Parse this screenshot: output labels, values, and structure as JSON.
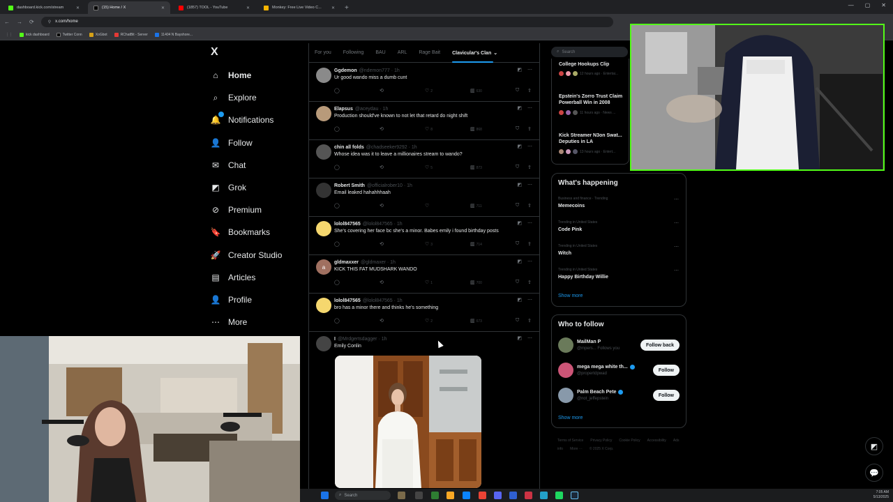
{
  "browser": {
    "tabs": [
      {
        "label": "dashboard.kick.com/stream",
        "color": "#53fc18",
        "active": false
      },
      {
        "label": "(15) Home / X",
        "color": "#000000",
        "active": true
      },
      {
        "label": "(1857) TOOL - YouTube",
        "color": "#ff0000",
        "active": false
      },
      {
        "label": "Monkey: Free Live Video C...",
        "color": "#f5b400",
        "active": false
      }
    ],
    "new_tab": "+",
    "address": "x.com/home",
    "bookmarks": [
      {
        "label": "kick dashboard",
        "color": "#53fc18"
      },
      {
        "label": "Twitter Conn",
        "color": "#000000"
      },
      {
        "label": "XoGbot",
        "color": "#d4a017"
      },
      {
        "label": "RChatBit - Server",
        "color": "#e53935"
      },
      {
        "label": "11404 N Bayshore...",
        "color": "#1a73e8"
      }
    ]
  },
  "x": {
    "logo": "X",
    "nav": [
      {
        "label": "Home",
        "icon": "home-icon",
        "glyph": "⌂",
        "bold": true
      },
      {
        "label": "Explore",
        "icon": "search-icon",
        "glyph": "⌕"
      },
      {
        "label": "Notifications",
        "icon": "bell-icon",
        "glyph": "🔔",
        "badge": true
      },
      {
        "label": "Follow",
        "icon": "person-plus-icon",
        "glyph": "👤"
      },
      {
        "label": "Chat",
        "icon": "mail-icon",
        "glyph": "✉"
      },
      {
        "label": "Grok",
        "icon": "grok-icon",
        "glyph": "◩"
      },
      {
        "label": "Premium",
        "icon": "premium-icon",
        "glyph": "⊘"
      },
      {
        "label": "Bookmarks",
        "icon": "bookmark-icon",
        "glyph": "🔖"
      },
      {
        "label": "Creator Studio",
        "icon": "rocket-icon",
        "glyph": "🚀"
      },
      {
        "label": "Articles",
        "icon": "article-icon",
        "glyph": "▤"
      },
      {
        "label": "Profile",
        "icon": "profile-icon",
        "glyph": "👤"
      },
      {
        "label": "More",
        "icon": "more-icon",
        "glyph": "⋯"
      }
    ],
    "timeline_tabs": [
      "For you",
      "Following",
      "BAU",
      "ARL",
      "Rage Bait",
      "Clavicular's Clan"
    ],
    "active_tab_chevron": "⌄",
    "tweets": [
      {
        "name": "Ggdemon",
        "handle": "@ndemon777 · 1h",
        "text": "Ur good wando miss a dumb cunt",
        "likes": "2",
        "views": "630",
        "avatar": "#8a8a8a"
      },
      {
        "name": "Elapsus",
        "handle": "@aceydau · 1h",
        "text": "Production should've known to not let that retard do night shift",
        "likes": "8",
        "views": "868",
        "avatar": "#b89a7a"
      },
      {
        "name": "chin all folds",
        "handle": "@chadseeker9292 · 1h",
        "text": "Whose idea was it to leave a millionaires stream to wando?",
        "likes": "5",
        "views": "873",
        "avatar": "#555555"
      },
      {
        "name": "Robert Smith",
        "handle": "@officialrober10 · 1h",
        "text": "Email leaked hahahhhaah",
        "likes": "",
        "views": "711",
        "avatar": "#333333"
      },
      {
        "name": "lolol847565",
        "handle": "@lolol847565 · 1h",
        "text": "She's covering her face bc she's a minor. Babes emily i found birthday posts",
        "likes": "3",
        "views": "714",
        "avatar": "#f5d76e"
      },
      {
        "name": "gldmaxxer",
        "handle": "@gldmaxer · 1h",
        "text": "KICK THIS FAT MUDSHARK WANDO",
        "likes": "1",
        "views": "700",
        "avatar": "#a07060",
        "initial": "a"
      },
      {
        "name": "lolol847565",
        "handle": "@lolol847565 · 1h",
        "text": "bro has a minor there and thinks he's something",
        "likes": "2",
        "views": "673",
        "avatar": "#f5d76e"
      },
      {
        "name": "I",
        "handle": "@Mrdgertsdagger · 1h",
        "text": "Emily Conlin",
        "likes": "",
        "views": "",
        "avatar": "#444444"
      }
    ]
  },
  "right": {
    "search_placeholder": "Search",
    "news": [
      {
        "title": "College Hookups Clip",
        "meta": "12 hours ago · Entertai..."
      },
      {
        "title": "Epstein's Zorro Trust Claim Powerball Win in 2008",
        "meta": "11 hours ago · News ..."
      },
      {
        "title": "Kick Streamer N3on Swat... Deputies in LA",
        "meta": "13 hours ago · Entert..."
      }
    ],
    "whats_happening": {
      "title": "What's happening",
      "trends": [
        {
          "category": "Business and finance · Trending",
          "name": "Memecoins"
        },
        {
          "category": "Trending in United States",
          "name": "Code Pink"
        },
        {
          "category": "Trending in United States",
          "name": "Witch"
        },
        {
          "category": "Trending in United States",
          "name": "Happy Birthday Willie"
        }
      ],
      "show_more": "Show more"
    },
    "who_to_follow": {
      "title": "Who to follow",
      "people": [
        {
          "name": "MailMan P",
          "handle": "@mpers... Follows you",
          "button": "Follow back",
          "avatar": "#6a7a5a",
          "verified": false
        },
        {
          "name": "mega mega white th...",
          "handle": "@propertdpwad",
          "button": "Follow",
          "avatar": "#cc5577",
          "verified": true
        },
        {
          "name": "Palm Beach Pete",
          "handle": "@not_jeffepstein",
          "button": "Follow",
          "avatar": "#8899aa",
          "verified": true
        }
      ],
      "show_more": "Show more"
    },
    "footer": [
      "Terms of Service",
      "Privacy Policy",
      "Cookie Policy",
      "Accessibility",
      "Ads info",
      "More ···",
      "© 2025 X Corp."
    ]
  },
  "taskbar": {
    "search_placeholder": "Search",
    "time": "7:05 AM",
    "date": "5/13/2025"
  },
  "window_controls": [
    "—",
    "▢",
    "✕"
  ]
}
